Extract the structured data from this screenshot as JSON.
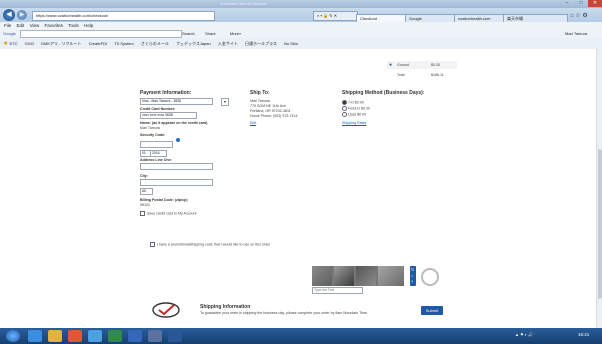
{
  "window": {
    "title": "Windows Internet Explorer",
    "controls": [
      "–",
      "□",
      "✕"
    ]
  },
  "browser": {
    "url": "https://www.ovationhealth.com/checkout/",
    "search_placeholder": "",
    "tabs": [
      {
        "label": "Checkout",
        "active": true
      },
      {
        "label": "Google",
        "active": false
      },
      {
        "label": "ovationhealth.com",
        "active": false
      },
      {
        "label": "楽天市場",
        "active": false
      }
    ],
    "menu": [
      "File",
      "Edit",
      "View",
      "Favorites",
      "Tools",
      "Help"
    ],
    "google_label": "Google",
    "google_search": "Search",
    "google_share": "Share",
    "google_more": "More»",
    "user": "Mari Tamura",
    "favorites": [
      "ETC",
      "GGG",
      "DMKアリ - リクルート",
      "CreateFDI",
      "TS System",
      "さくらのメール",
      "フェデックスJapan",
      "入金サイト",
      "日通ホールプラス",
      "Nu Skin"
    ]
  },
  "order_summary": {
    "row1_label": "Ground",
    "row1_value": "$0.00",
    "row2_label": "Total",
    "row2_value": "$188.11"
  },
  "payment": {
    "title": "Payment Information:",
    "visa_label": "Visa - Mari Tamura - 3838",
    "cc_number_label": "Credit Card Number:",
    "cc_number_value": "xxxx xxxx xxxx 3838",
    "name_label": "Name: (as it appears on the credit card)",
    "name_value": "Mari Tamura",
    "security_label": "Security Code:",
    "exp_month": "01",
    "exp_year": "2016",
    "address_label": "Address Line One:",
    "city_label": "City:",
    "state_value": "AK",
    "zip_label": "Billing Postal Code: (zip/cp)",
    "zip_value": "98102",
    "save_card_label": "Save credit card to My Account"
  },
  "shipto": {
    "title": "Ship To:",
    "lines": [
      "Mari Tamura",
      "775 SOM NE 11th Ave",
      "Portland, OR 97232-3811",
      "Home Phone: (503) 573-7414"
    ],
    "edit_label": "Edit"
  },
  "shipping_method": {
    "title": "Shipping Method (Business Days):",
    "options": [
      {
        "label": "7-D $0.00",
        "selected": true
      },
      {
        "label": "Fed3-D $5.00",
        "selected": false
      },
      {
        "label": "Upss $0.00",
        "selected": false
      }
    ],
    "rates_link": "Shipping Rates"
  },
  "promo_label": "I have a promotional/shipping code that I would like to use on this order",
  "captcha": {
    "input_placeholder": "Type the Text"
  },
  "footer": {
    "title": "Shipping Information",
    "text": "To guarantee your order is shipping the business day, please complete your order by 8am Mountain Time.",
    "submit_label": "Submit"
  },
  "taskbar": {
    "clock": "16:21",
    "date": ""
  }
}
